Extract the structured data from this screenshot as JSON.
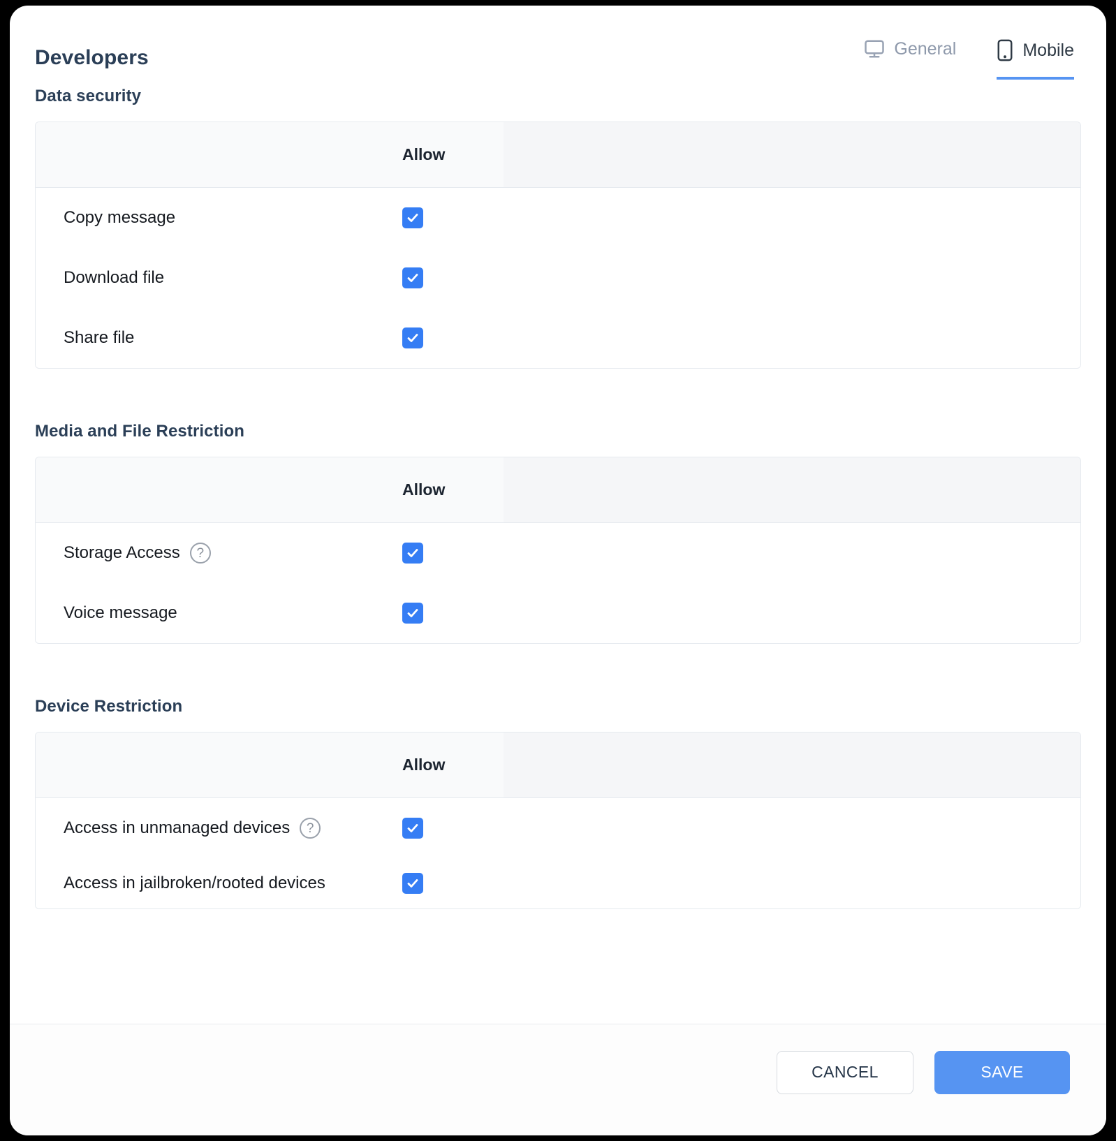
{
  "header": {
    "title": "Developers",
    "tabs": [
      {
        "label": "General",
        "icon": "desktop-monitor-icon",
        "active": false
      },
      {
        "label": "Mobile",
        "icon": "mobile-phone-icon",
        "active": true
      }
    ]
  },
  "sections": [
    {
      "title": "Data security",
      "column_header": "Allow",
      "rows": [
        {
          "label": "Copy message",
          "checked": true,
          "help": false
        },
        {
          "label": "Download file",
          "checked": true,
          "help": false
        },
        {
          "label": "Share file",
          "checked": true,
          "help": false
        }
      ]
    },
    {
      "title": "Media and File Restriction",
      "column_header": "Allow",
      "rows": [
        {
          "label": "Storage Access",
          "checked": true,
          "help": true
        },
        {
          "label": "Voice message",
          "checked": true,
          "help": false
        }
      ]
    },
    {
      "title": "Device Restriction",
      "column_header": "Allow",
      "rows": [
        {
          "label": "Access in unmanaged devices",
          "checked": true,
          "help": true
        },
        {
          "label": "Access in jailbroken/rooted devices",
          "checked": true,
          "help": false
        }
      ]
    }
  ],
  "footer": {
    "cancel_label": "CANCEL",
    "save_label": "SAVE"
  },
  "colors": {
    "accent_blue": "#5694f2",
    "checkbox_blue": "#357df4",
    "heading_navy": "#2b3f57",
    "muted_gray": "#8e99ab"
  },
  "icons": {
    "help": "?"
  }
}
